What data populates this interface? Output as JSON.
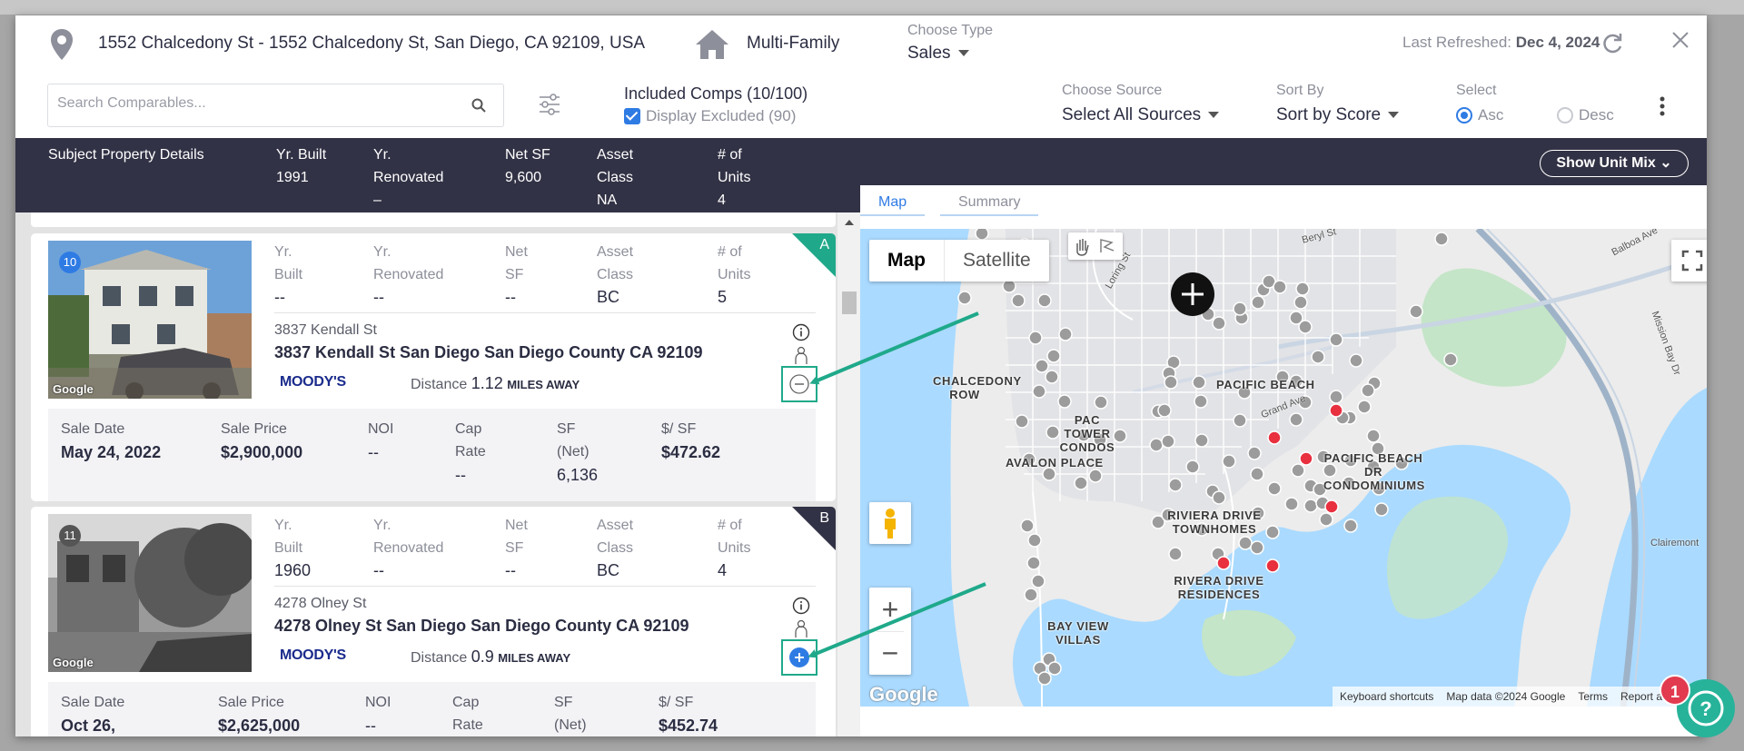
{
  "header": {
    "address": "1552 Chalcedony St - 1552 Chalcedony St, San Diego, CA 92109, USA",
    "property_type": "Multi-Family",
    "choose_type_label": "Choose Type",
    "choose_type_value": "Sales",
    "last_refreshed_label": "Last Refreshed:",
    "last_refreshed_value": "Dec 4, 2024"
  },
  "toolbar": {
    "search_placeholder": "Search Comparables...",
    "included_comps": "Included Comps (10/100)",
    "display_excluded": "Display Excluded (90)",
    "choose_source_label": "Choose Source",
    "choose_source_value": "Select All Sources",
    "sort_by_label": "Sort By",
    "sort_by_value": "Sort by Score",
    "select_label": "Select",
    "asc_label": "Asc",
    "desc_label": "Desc"
  },
  "subject": {
    "title": "Subject Property Details",
    "yr_built_label": "Yr. Built",
    "yr_built": "1991",
    "yr_renovated_label": "Yr. Renovated",
    "yr_renovated": "–",
    "net_sf_label": "Net SF",
    "net_sf": "9,600",
    "asset_class_label": "Asset Class",
    "asset_class": "NA",
    "units_label": "# of Units",
    "units": "4"
  },
  "right_panel": {
    "show_unit_mix": "Show Unit Mix",
    "tabs": [
      "Map",
      "Summary"
    ],
    "map_type_buttons": [
      "Map",
      "Satellite"
    ],
    "map_labels": [
      "PACIFIC BEACH",
      "CHALCEDONY ROW",
      "PAC TOWER CONDOS",
      "AVALON PLACE",
      "PACIFIC BEACH DR CONDOMINIUMS",
      "RIVIERA DRIVE TOWNHOMES",
      "RIVERA DRIVE RESIDENCES",
      "BAY VIEW VILLAS"
    ],
    "streets": [
      "Beryl St",
      "Loring St",
      "Balboa Ave",
      "Grand Ave",
      "Mission Bay Dr",
      "Clairemont"
    ],
    "attribution": [
      "Keyboard shortcuts",
      "Map data ©2024 Google",
      "Terms",
      "Report a map error"
    ],
    "google": "Google"
  },
  "labels": {
    "yr_built": "Yr. Built",
    "yr_renovated": "Yr. Renovated",
    "net_sf": "Net SF",
    "asset_class": "Asset Class",
    "units": "# of Units",
    "sale_date": "Sale Date",
    "sale_price": "Sale Price",
    "noi": "NOI",
    "cap_rate": "Cap Rate",
    "sf_net": "SF (Net)",
    "per_sf": "$/ SF",
    "distance": "Distance",
    "miles_away": "MILES AWAY",
    "source": "MOODY'S"
  },
  "comps": [
    {
      "rank": "10",
      "grade": "A",
      "yr_built": "--",
      "yr_renovated": "--",
      "net_sf": "--",
      "asset_class": "BC",
      "units": "5",
      "short_address": "3837 Kendall St",
      "full_address": "3837 Kendall St San Diego San Diego County CA 92109",
      "distance": "1.12",
      "sale_date": "May 24, 2022",
      "sale_price": "$2,900,000",
      "noi": "--",
      "cap_rate": "--",
      "sf_net": "6,136",
      "per_sf": "$472.62",
      "included": true
    },
    {
      "rank": "11",
      "grade": "B",
      "yr_built": "1960",
      "yr_renovated": "--",
      "net_sf": "--",
      "asset_class": "BC",
      "units": "4",
      "short_address": "4278 Olney St",
      "full_address": "4278 Olney St San Diego San Diego County CA 92109",
      "distance": "0.9",
      "sale_date": "Oct 26,",
      "sale_price": "$2,625,000",
      "noi": "--",
      "cap_rate": "",
      "sf_net": "",
      "per_sf": "$452.74",
      "included": false
    }
  ],
  "help": {
    "badge": "1"
  },
  "colors": {
    "accent": "#2f7be4",
    "dark": "#323246",
    "teal": "#1fa98a",
    "marker_red": "#e8303f",
    "marker_grey": "#9a9a9a"
  }
}
